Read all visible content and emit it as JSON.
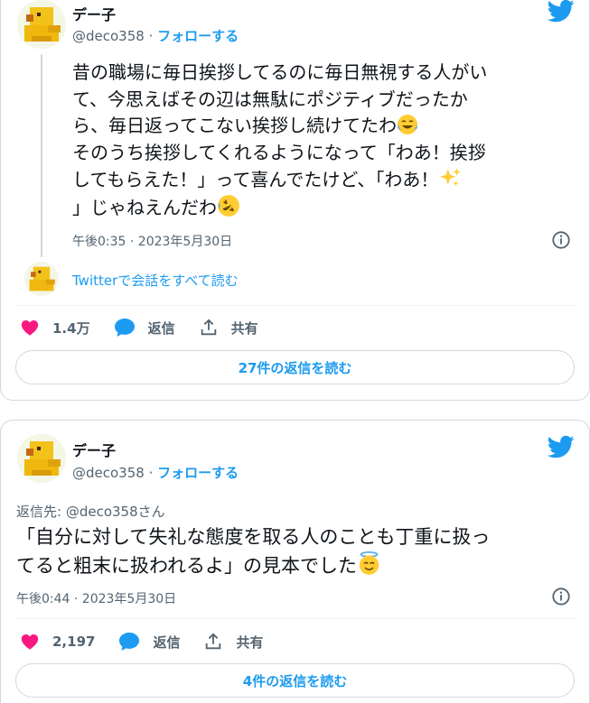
{
  "tweets": [
    {
      "author": {
        "name": "デー子",
        "handle": "@deco358",
        "separator": " · ",
        "follow_label": "フォローする"
      },
      "body_lines": [
        "昔の職場に毎日挨拶してるのに毎日無視する人がい",
        "て、今思えばその辺は無駄にポジティブだったか",
        "ら、毎日返ってこない挨拶し続けてたわ",
        "そのうち挨拶してくれるようになって「わあ！挨拶",
        "してもらえた！」って喜んでたけど、「わあ！",
        "」じゃねえんだわ"
      ],
      "emojis": [
        "face-with-tears-of-joy",
        "sparkles",
        "rolling-on-floor-laughing"
      ],
      "timestamp": "午後0:35 · 2023年5月30日",
      "read_conversation": "Twitterで会話をすべて読む",
      "likes": "1.4万",
      "reply_label": "返信",
      "share_label": "共有",
      "replies_button": "27件の返信を読む"
    },
    {
      "author": {
        "name": "デー子",
        "handle": "@deco358",
        "separator": " · ",
        "follow_label": "フォローする"
      },
      "reply_to_prefix": "返信先: ",
      "reply_to_handle": "@deco358さん",
      "body_lines": [
        "「自分に対して失礼な態度を取る人のことも丁重に扱っ",
        "てると粗末に扱われるよ」の見本でした"
      ],
      "emojis": [
        "smiling-face-with-halo"
      ],
      "timestamp": "午後0:44 · 2023年5月30日",
      "likes": "2,197",
      "reply_label": "返信",
      "share_label": "共有",
      "replies_button": "4件の返信を読む"
    }
  ],
  "colors": {
    "twitter_blue": "#1d9bf0",
    "like_pink": "#f91880",
    "secondary_text": "#536471",
    "border": "#cfd9de"
  },
  "icons": [
    "avatar-duck",
    "twitter-bird-icon",
    "info-icon",
    "heart-icon",
    "reply-bubble-icon",
    "share-icon"
  ]
}
